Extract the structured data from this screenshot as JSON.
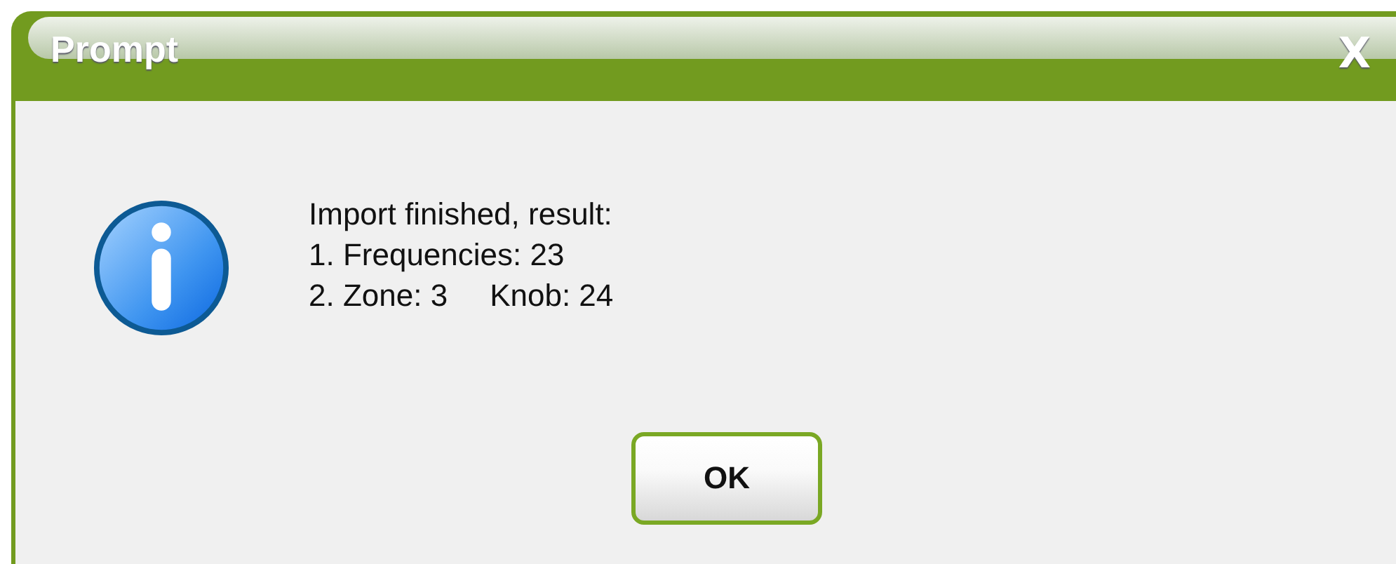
{
  "dialog": {
    "title": "Prompt",
    "close": "X",
    "message": [
      [
        "Import finished, result:"
      ],
      [
        "1. Frequencies: 23"
      ],
      [
        "2. Zone: 3",
        "Knob: 24"
      ]
    ],
    "buttons": [
      "OK"
    ]
  }
}
